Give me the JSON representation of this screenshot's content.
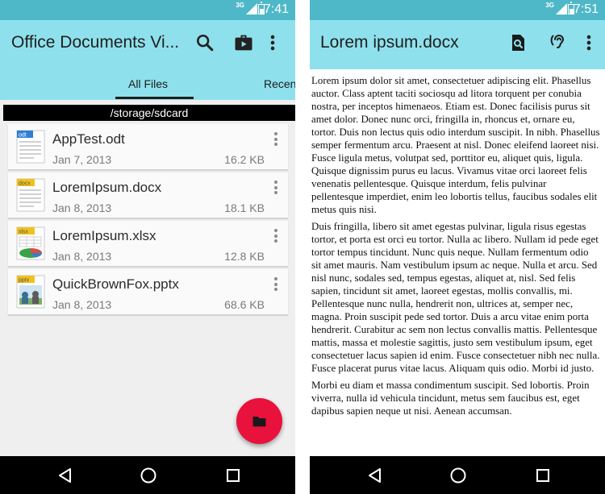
{
  "left": {
    "status": {
      "network": "3G",
      "time": "7:41"
    },
    "app_title": "Office Documents Vi...",
    "actions": {
      "search_icon": "search-icon",
      "briefcase_icon": "briefcase-icon",
      "overflow_icon": "overflow-menu-icon"
    },
    "tabs": [
      {
        "label": "All Files",
        "selected": true
      },
      {
        "label": "Recen",
        "selected": false
      }
    ],
    "path": "/storage/sdcard",
    "files": [
      {
        "name": "AppTest.odt",
        "date": "Jan 7, 2013",
        "size": "16.2 KB",
        "badge": "odt",
        "icon": "odt-file-icon"
      },
      {
        "name": "LoremIpsum.docx",
        "date": "Jan 8, 2013",
        "size": "18.1 KB",
        "badge": "docx",
        "icon": "docx-file-icon"
      },
      {
        "name": "LoremIpsum.xlsx",
        "date": "Jan 8, 2013",
        "size": "12.8 KB",
        "badge": "xlsx",
        "icon": "xlsx-file-icon"
      },
      {
        "name": "QuickBrownFox.pptx",
        "date": "Jan 8, 2013",
        "size": "68.6 KB",
        "badge": "pptx",
        "icon": "pptx-file-icon"
      }
    ],
    "fab_icon": "folder-icon"
  },
  "right": {
    "status": {
      "network": "3G",
      "time": "7:51"
    },
    "doc_title": "Lorem ipsum.docx",
    "actions": {
      "find_icon": "find-in-page-icon",
      "tts_icon": "hearing-icon",
      "overflow_icon": "overflow-menu-icon"
    },
    "paragraphs": [
      "Lorem ipsum dolor sit amet, consectetuer adipiscing elit. Phasellus auctor. Class aptent taciti sociosqu ad litora torquent per conubia nostra, per inceptos himenaeos. Etiam est. Donec facilisis purus sit amet dolor. Donec nunc orci, fringilla in, rhoncus et, ornare eu, tortor. Duis non lectus quis odio interdum suscipit. In nibh. Phasellus semper fermentum arcu. Praesent at nisl. Donec eleifend laoreet nisi. Fusce ligula metus, volutpat sed, porttitor eu, aliquet quis, ligula. Quisque dignissim purus eu lacus. Vivamus vitae orci laoreet felis venenatis pellentesque. Quisque interdum, felis pulvinar pellentesque imperdiet, enim leo lobortis tellus, faucibus sodales elit metus quis nisi.",
      "Duis fringilla, libero sit amet egestas pulvinar, ligula risus egestas tortor, et porta est orci eu tortor. Nulla ac libero. Nullam id pede eget tortor tempus tincidunt. Nunc quis neque. Nullam fermentum odio sit amet mauris. Nam vestibulum ipsum ac neque. Nulla et arcu. Sed nisl nunc, sodales sed, tempus egestas, aliquet at, nisl. Sed felis sapien, tincidunt sit amet, laoreet egestas, mollis convallis, mi. Pellentesque nunc nulla, hendrerit non, ultrices at, semper nec, magna. Proin suscipit pede sed tortor. Duis a arcu vitae enim porta hendrerit. Curabitur ac sem non lectus convallis mattis. Pellentesque mattis, massa et molestie sagittis, justo sem vestibulum ipsum, eget consectetuer lacus sapien id enim. Fusce consectetuer nibh nec nulla. Fusce placerat purus vitae lacus. Aliquam quis odio. Morbi id justo.",
      "Morbi eu diam et massa condimentum suscipit. Sed lobortis. Proin viverra, nulla id vehicula tincidunt, metus sem faucibus est, eget dapibus sapien neque ut nisi. Aenean accumsan."
    ]
  },
  "navigation": {
    "back_icon": "back-icon",
    "home_icon": "home-icon",
    "recents_icon": "recents-icon"
  },
  "colors": {
    "status_bar": "#4fb8c8",
    "app_bar": "#8ee1ec",
    "fab": "#e8123d",
    "nav_bar": "#000000"
  }
}
